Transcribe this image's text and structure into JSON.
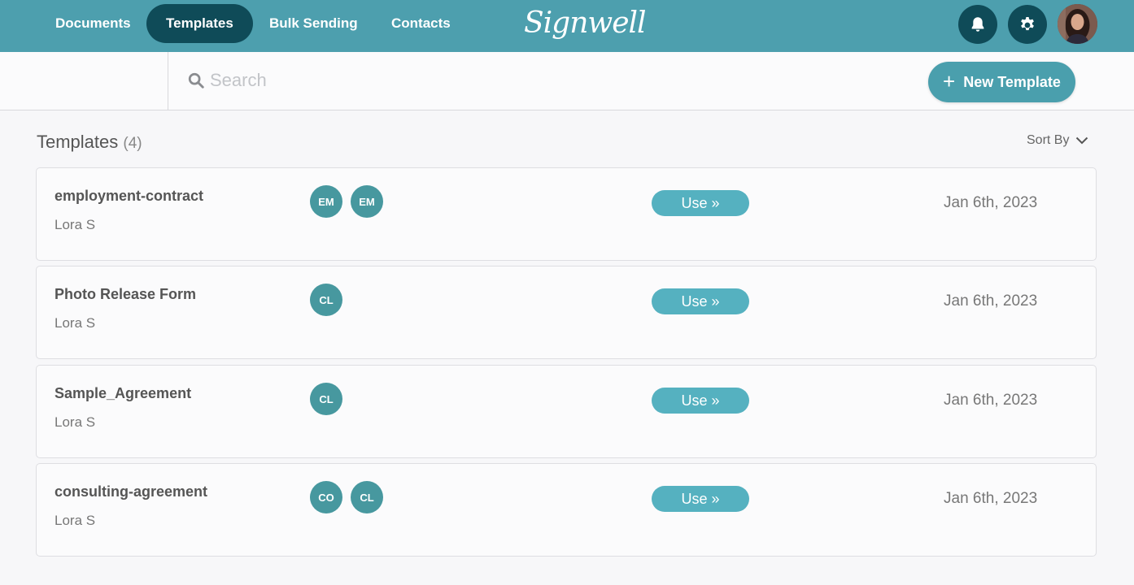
{
  "nav": {
    "items": [
      {
        "label": "Documents",
        "active": false
      },
      {
        "label": "Templates",
        "active": true
      },
      {
        "label": "Bulk Sending",
        "active": false
      },
      {
        "label": "Contacts",
        "active": false
      }
    ],
    "logo": "Signwell"
  },
  "toolbar": {
    "search_placeholder": "Search",
    "new_template_label": "New Template"
  },
  "section": {
    "title": "Templates",
    "count": "(4)",
    "sort_label": "Sort By"
  },
  "templates": [
    {
      "name": "employment-contract",
      "owner": "Lora S",
      "recipients": [
        "EM",
        "EM"
      ],
      "action": "Use »",
      "date": "Jan 6th, 2023"
    },
    {
      "name": "Photo Release Form",
      "owner": "Lora S",
      "recipients": [
        "CL"
      ],
      "action": "Use »",
      "date": "Jan 6th, 2023"
    },
    {
      "name": "Sample_Agreement",
      "owner": "Lora S",
      "recipients": [
        "CL"
      ],
      "action": "Use »",
      "date": "Jan 6th, 2023"
    },
    {
      "name": "consulting-agreement",
      "owner": "Lora S",
      "recipients": [
        "CO",
        "CL"
      ],
      "action": "Use »",
      "date": "Jan 6th, 2023"
    }
  ],
  "colors": {
    "nav_bg": "#4d9fae",
    "nav_active": "#0f4b58",
    "accent": "#55b1c0",
    "badge": "#47989f"
  }
}
